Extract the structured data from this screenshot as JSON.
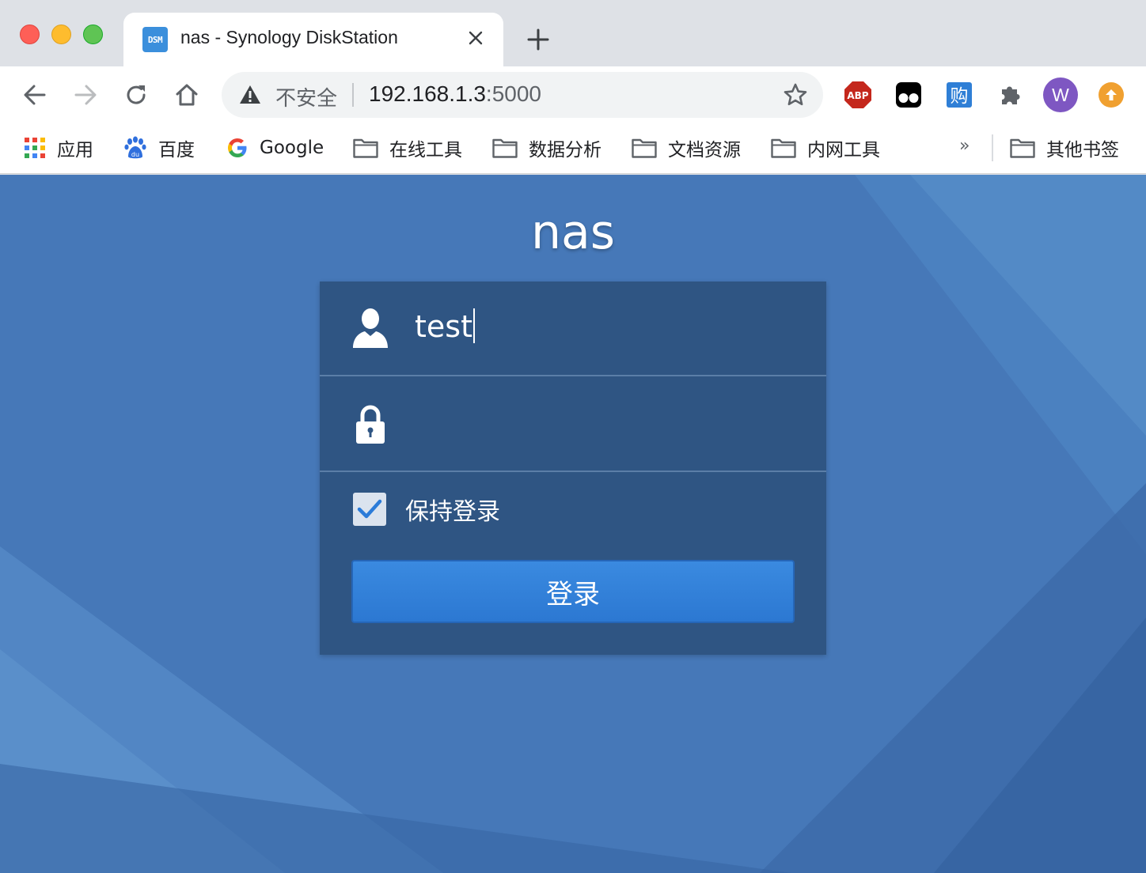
{
  "browser": {
    "tab": {
      "favicon_text": "DSM",
      "title": "nas - Synology DiskStation"
    },
    "address_bar": {
      "security_label": "不安全",
      "host": "192.168.1.3",
      "port": ":5000"
    },
    "profile_initial": "W",
    "extensions": {
      "abp_label": "ABP",
      "gou_label": "购"
    },
    "bookmarks": [
      {
        "label": "应用",
        "icon": "apps-grid-icon"
      },
      {
        "label": "百度",
        "icon": "baidu-paw-icon"
      },
      {
        "label": "Google",
        "icon": "google-g-icon"
      },
      {
        "label": "在线工具",
        "icon": "folder-icon"
      },
      {
        "label": "数据分析",
        "icon": "folder-icon"
      },
      {
        "label": "文档资源",
        "icon": "folder-icon"
      },
      {
        "label": "内网工具",
        "icon": "folder-icon"
      }
    ],
    "bookmarks_overflow": "»",
    "other_bookmarks": "其他书签"
  },
  "login": {
    "hostname": "nas",
    "username_value": "test",
    "password_value": "",
    "remember_label": "保持登录",
    "remember_checked": true,
    "submit_label": "登录"
  },
  "colors": {
    "page_bg": "#4678b8",
    "panel_bg": "#2f5583",
    "button_bg": "#3182dc",
    "avatar": "#7e57c2"
  }
}
